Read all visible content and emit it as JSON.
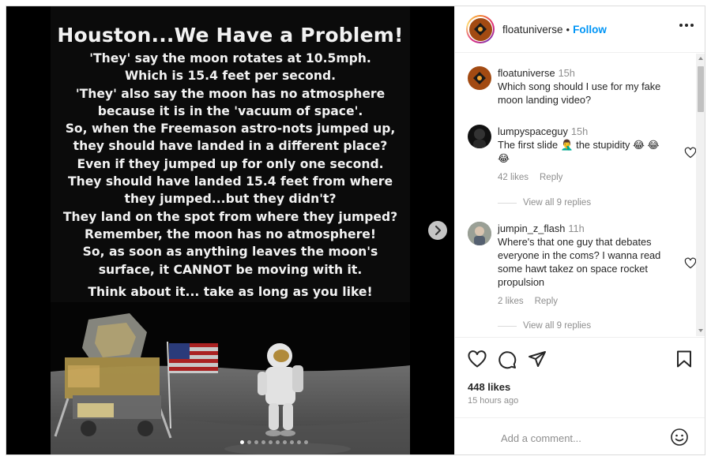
{
  "post": {
    "headline": "Houston...We Have a Problem!",
    "lines": [
      "'They' say the moon rotates at 10.5mph.",
      "Which is 15.4 feet per second.",
      "'They' also say the moon has no atmosphere",
      "because it is in the 'vacuum of space'.",
      "So, when the Freemason astro-nots jumped up,",
      "they should have landed in a different place?",
      "Even if they jumped up for only one second.",
      "They should have landed 15.4 feet from where",
      "they jumped...but they didn't?",
      "They land on the spot from where they jumped?",
      "Remember, the moon has no atmosphere!",
      "So, as soon as anything leaves the moon's",
      "surface, it CANNOT be moving with it."
    ],
    "closing": "Think about it... take as long as you like!",
    "slide_count": 10,
    "active_slide": 1
  },
  "header": {
    "username": "floatuniverse",
    "separator": "•",
    "follow_label": "Follow"
  },
  "comments": [
    {
      "username": "floatuniverse",
      "time": "15h",
      "text": "Which song should I use for my fake moon landing video?"
    },
    {
      "username": "lumpyspaceguy",
      "time": "15h",
      "text": "The first slide 🤦‍♂️ the stupidity 😂 😂 😂",
      "likes": "42 likes",
      "reply_label": "Reply",
      "view_replies": "View all 9 replies"
    },
    {
      "username": "jumpin_z_flash",
      "time": "11h",
      "text": "Where's that one guy that debates everyone in the coms? I wanna read some hawt takez on space rocket propulsion",
      "likes": "2 likes",
      "reply_label": "Reply",
      "view_replies": "View all 9 replies"
    }
  ],
  "footer": {
    "likes": "448 likes",
    "time_ago": "15 hours ago",
    "comment_placeholder": "Add a comment..."
  },
  "icons": {
    "like": "heart-icon",
    "comment": "comment-icon",
    "share": "share-icon",
    "save": "bookmark-icon",
    "more": "more-options-icon",
    "next": "chevron-right-icon",
    "emoji": "emoji-icon"
  },
  "colors": {
    "accent": "#0095f6",
    "muted": "#8e8e8e",
    "text": "#262626",
    "avatar_brand": "#a24a12"
  }
}
